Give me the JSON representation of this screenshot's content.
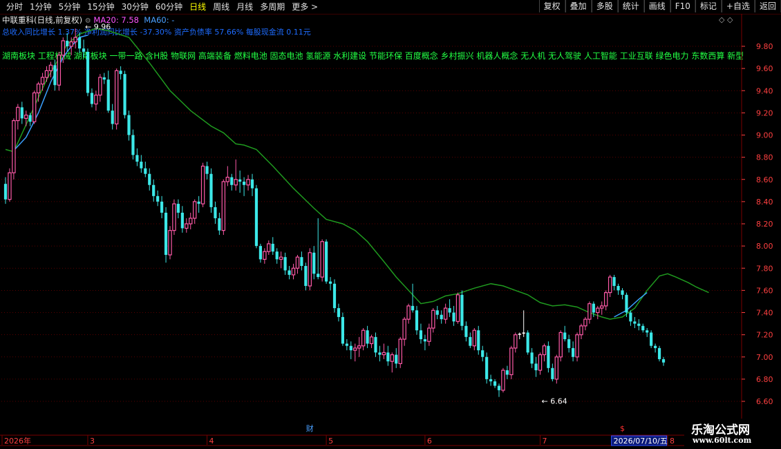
{
  "toolbar": {
    "left": [
      "分时",
      "1分钟",
      "5分钟",
      "15分钟",
      "30分钟",
      "60分钟",
      "日线",
      "周线",
      "月线",
      "多周期",
      "更多 >"
    ],
    "active_index": 6,
    "right": [
      "复权",
      "叠加",
      "多股",
      "统计",
      "画线",
      "F10",
      "标记",
      "+自选",
      "返回"
    ]
  },
  "info": {
    "name": "中联重科(日线,前复权)",
    "ma20": "MA20: 7.58",
    "ma60": "MA60: -",
    "diamonds": "◇ ◇"
  },
  "stats_text": "总收入同比增长 1.37%  净利润同比增长 -37.30%  资产负债率 57.66%  每股现金流 0.11元",
  "concepts_text": "湖南板块 工程机械 湖南板块 一带一路 含H股 物联网 高端装备 燃料电池 固态电池 氢能源 水利建设 节能环保 百度概念 乡村振兴 机器人概念 无人机 无人驾驶 人工智能 工业互联 绿色电力 东数西算 新型工业",
  "logo": {
    "line1": "乐淘公式网",
    "line2": "www.60lt.com"
  },
  "chart_data": {
    "type": "candlestick",
    "ylim": [
      6.5,
      10.0
    ],
    "y_ticks": [
      "6.60",
      "6.80",
      "7.00",
      "7.20",
      "7.40",
      "7.60",
      "7.80",
      "8.00",
      "8.20",
      "8.40",
      "8.60",
      "8.80",
      "9.00",
      "9.20",
      "9.40",
      "9.60",
      "9.80"
    ],
    "x_labels": [
      {
        "label": "2026年",
        "index": 0
      },
      {
        "label": "3",
        "index": 20
      },
      {
        "label": "4",
        "index": 49
      },
      {
        "label": "5",
        "index": 78
      },
      {
        "label": "6",
        "index": 102
      },
      {
        "label": "7",
        "index": 130
      },
      {
        "label": "8",
        "index": 161
      }
    ],
    "cursor_date": "2026/07/10/五",
    "cursor_index": 148,
    "markers": [
      {
        "label": "财",
        "index": 74
      },
      {
        "label": "$",
        "index": 150
      }
    ],
    "annotations": [
      {
        "text": "9.96",
        "index": 19
      },
      {
        "text": "6.64",
        "index": 130
      }
    ],
    "colors": {
      "up": "#ff5aa8",
      "down": "#3ce8e8",
      "ma20": "#1f9a1f",
      "ma_blue": "#3aa0ff",
      "tick": "#ff4040",
      "grid": "#7a0000"
    },
    "ohlc": [
      [
        8.56,
        8.62,
        8.38,
        8.42
      ],
      [
        8.42,
        8.7,
        8.4,
        8.66
      ],
      [
        8.66,
        9.15,
        8.6,
        9.13
      ],
      [
        9.13,
        9.28,
        9.05,
        9.25
      ],
      [
        9.25,
        9.3,
        9.1,
        9.15
      ],
      [
        9.15,
        9.22,
        9.08,
        9.18
      ],
      [
        9.18,
        9.2,
        9.08,
        9.12
      ],
      [
        9.12,
        9.4,
        9.1,
        9.38
      ],
      [
        9.38,
        9.48,
        9.3,
        9.46
      ],
      [
        9.46,
        9.56,
        9.4,
        9.52
      ],
      [
        9.52,
        9.62,
        9.48,
        9.58
      ],
      [
        9.58,
        9.66,
        9.52,
        9.63
      ],
      [
        9.63,
        9.68,
        9.4,
        9.45
      ],
      [
        9.45,
        9.75,
        9.4,
        9.72
      ],
      [
        9.72,
        9.88,
        9.65,
        9.85
      ],
      [
        9.85,
        9.92,
        9.75,
        9.8
      ],
      [
        9.8,
        9.88,
        9.72,
        9.84
      ],
      [
        9.84,
        9.96,
        9.78,
        9.88
      ],
      [
        9.88,
        9.92,
        9.74,
        9.78
      ],
      [
        9.78,
        9.86,
        9.7,
        9.75
      ],
      [
        9.75,
        9.78,
        9.35,
        9.38
      ],
      [
        9.38,
        9.42,
        9.25,
        9.28
      ],
      [
        9.28,
        9.4,
        9.22,
        9.36
      ],
      [
        9.36,
        9.55,
        9.3,
        9.52
      ],
      [
        9.52,
        9.56,
        9.46,
        9.5
      ],
      [
        9.5,
        9.58,
        9.2,
        9.22
      ],
      [
        9.22,
        9.28,
        9.05,
        9.1
      ],
      [
        9.1,
        9.6,
        9.05,
        9.58
      ],
      [
        9.58,
        9.62,
        9.5,
        9.55
      ],
      [
        9.55,
        9.58,
        9.15,
        9.18
      ],
      [
        9.18,
        9.22,
        8.95,
        9.0
      ],
      [
        9.0,
        9.05,
        8.78,
        8.82
      ],
      [
        8.82,
        8.88,
        8.72,
        8.76
      ],
      [
        8.76,
        8.82,
        8.66,
        8.7
      ],
      [
        8.7,
        8.76,
        8.62,
        8.65
      ],
      [
        8.65,
        8.7,
        8.5,
        8.55
      ],
      [
        8.55,
        8.6,
        8.4,
        8.45
      ],
      [
        8.45,
        8.5,
        8.36,
        8.4
      ],
      [
        8.4,
        8.45,
        8.25,
        8.3
      ],
      [
        8.3,
        8.35,
        7.85,
        7.92
      ],
      [
        7.92,
        8.18,
        7.88,
        8.14
      ],
      [
        8.14,
        8.42,
        8.1,
        8.38
      ],
      [
        8.38,
        8.42,
        8.25,
        8.3
      ],
      [
        8.3,
        8.36,
        8.12,
        8.16
      ],
      [
        8.16,
        8.25,
        8.12,
        8.2
      ],
      [
        8.2,
        8.3,
        8.15,
        8.25
      ],
      [
        8.25,
        8.42,
        8.2,
        8.4
      ],
      [
        8.4,
        8.45,
        8.3,
        8.38
      ],
      [
        8.38,
        8.75,
        8.35,
        8.72
      ],
      [
        8.72,
        8.76,
        8.6,
        8.65
      ],
      [
        8.65,
        8.7,
        8.3,
        8.35
      ],
      [
        8.35,
        8.4,
        8.2,
        8.25
      ],
      [
        8.25,
        8.3,
        8.1,
        8.14
      ],
      [
        8.14,
        8.6,
        8.1,
        8.58
      ],
      [
        8.58,
        8.72,
        8.54,
        8.62
      ],
      [
        8.62,
        8.65,
        8.5,
        8.55
      ],
      [
        8.55,
        8.78,
        8.5,
        8.6
      ],
      [
        8.6,
        8.68,
        8.48,
        8.58
      ],
      [
        8.58,
        8.62,
        8.45,
        8.55
      ],
      [
        8.55,
        8.64,
        8.5,
        8.6
      ],
      [
        8.6,
        8.65,
        8.45,
        8.52
      ],
      [
        8.52,
        8.55,
        7.98,
        8.0
      ],
      [
        8.0,
        8.02,
        7.85,
        7.88
      ],
      [
        7.88,
        7.98,
        7.84,
        7.95
      ],
      [
        7.95,
        8.05,
        7.92,
        8.02
      ],
      [
        8.02,
        8.08,
        7.92,
        7.95
      ],
      [
        7.95,
        7.98,
        7.84,
        7.88
      ],
      [
        7.88,
        7.95,
        7.8,
        7.9
      ],
      [
        7.9,
        7.94,
        7.74,
        7.78
      ],
      [
        7.78,
        7.82,
        7.7,
        7.74
      ],
      [
        7.74,
        7.84,
        7.7,
        7.8
      ],
      [
        7.8,
        7.92,
        7.75,
        7.9
      ],
      [
        7.9,
        7.95,
        7.78,
        7.82
      ],
      [
        7.82,
        7.85,
        7.6,
        7.64
      ],
      [
        7.64,
        7.98,
        7.6,
        7.94
      ],
      [
        7.94,
        8.0,
        7.7,
        7.75
      ],
      [
        7.75,
        8.25,
        7.7,
        7.72
      ],
      [
        7.72,
        8.06,
        7.68,
        8.04
      ],
      [
        8.04,
        8.06,
        7.66,
        7.68
      ],
      [
        7.68,
        7.72,
        7.6,
        7.66
      ],
      [
        7.66,
        7.7,
        7.4,
        7.44
      ],
      [
        7.44,
        7.48,
        7.32,
        7.36
      ],
      [
        7.36,
        7.4,
        7.1,
        7.12
      ],
      [
        7.12,
        7.16,
        7.06,
        7.1
      ],
      [
        7.1,
        7.14,
        6.98,
        7.06
      ],
      [
        7.06,
        7.12,
        6.96,
        7.08
      ],
      [
        7.08,
        7.18,
        7.0,
        7.1
      ],
      [
        7.1,
        7.26,
        7.06,
        7.24
      ],
      [
        7.24,
        7.28,
        7.08,
        7.12
      ],
      [
        7.12,
        7.2,
        7.08,
        7.18
      ],
      [
        7.18,
        7.22,
        7.0,
        7.04
      ],
      [
        7.04,
        7.1,
        6.96,
        7.02
      ],
      [
        7.02,
        7.12,
        6.98,
        7.04
      ],
      [
        7.04,
        7.1,
        6.92,
        6.96
      ],
      [
        6.96,
        7.04,
        6.86,
        7.02
      ],
      [
        7.02,
        7.08,
        6.9,
        6.94
      ],
      [
        6.94,
        7.18,
        6.9,
        7.16
      ],
      [
        7.16,
        7.36,
        7.1,
        7.34
      ],
      [
        7.34,
        7.48,
        7.3,
        7.46
      ],
      [
        7.46,
        7.66,
        7.4,
        7.42
      ],
      [
        7.42,
        7.46,
        7.2,
        7.24
      ],
      [
        7.24,
        7.3,
        7.12,
        7.16
      ],
      [
        7.16,
        7.2,
        7.06,
        7.14
      ],
      [
        7.14,
        7.3,
        7.1,
        7.26
      ],
      [
        7.26,
        7.44,
        7.22,
        7.42
      ],
      [
        7.42,
        7.46,
        7.34,
        7.38
      ],
      [
        7.38,
        7.42,
        7.3,
        7.34
      ],
      [
        7.34,
        7.48,
        7.3,
        7.44
      ],
      [
        7.44,
        7.52,
        7.36,
        7.4
      ],
      [
        7.4,
        7.46,
        7.28,
        7.32
      ],
      [
        7.32,
        7.58,
        7.3,
        7.56
      ],
      [
        7.56,
        7.6,
        7.24,
        7.28
      ],
      [
        7.28,
        7.32,
        7.14,
        7.18
      ],
      [
        7.18,
        7.22,
        7.08,
        7.1
      ],
      [
        7.1,
        7.26,
        7.06,
        7.24
      ],
      [
        7.24,
        7.28,
        7.02,
        7.06
      ],
      [
        7.06,
        7.1,
        6.96,
        7.0
      ],
      [
        7.0,
        7.04,
        6.76,
        6.8
      ],
      [
        6.8,
        6.84,
        6.74,
        6.78
      ],
      [
        6.78,
        6.8,
        6.72,
        6.74
      ],
      [
        6.74,
        6.76,
        6.64,
        6.7
      ],
      [
        6.7,
        6.9,
        6.68,
        6.88
      ],
      [
        6.88,
        6.92,
        6.8,
        6.84
      ],
      [
        6.84,
        7.1,
        6.8,
        7.08
      ],
      [
        7.08,
        7.22,
        7.04,
        7.2
      ],
      [
        7.2,
        7.22,
        7.16,
        7.21
      ],
      [
        7.21,
        7.42,
        7.18,
        7.22
      ],
      [
        7.22,
        7.24,
        7.02,
        7.04
      ],
      [
        7.04,
        7.08,
        6.9,
        6.94
      ],
      [
        6.94,
        7.0,
        6.82,
        6.88
      ],
      [
        6.88,
        7.04,
        6.84,
        7.02
      ],
      [
        7.02,
        7.12,
        6.96,
        7.1
      ],
      [
        7.1,
        7.14,
        6.86,
        6.9
      ],
      [
        6.9,
        6.94,
        6.78,
        6.8
      ],
      [
        6.8,
        7.02,
        6.76,
        7.0
      ],
      [
        7.0,
        7.24,
        6.96,
        7.22
      ],
      [
        7.22,
        7.28,
        7.14,
        7.16
      ],
      [
        7.16,
        7.2,
        7.04,
        7.08
      ],
      [
        7.08,
        7.14,
        6.96,
        7.0
      ],
      [
        7.0,
        7.22,
        6.96,
        7.2
      ],
      [
        7.2,
        7.3,
        7.16,
        7.28
      ],
      [
        7.28,
        7.36,
        7.24,
        7.34
      ],
      [
        7.34,
        7.5,
        7.3,
        7.48
      ],
      [
        7.48,
        7.5,
        7.36,
        7.4
      ],
      [
        7.4,
        7.46,
        7.34,
        7.44
      ],
      [
        7.44,
        7.5,
        7.38,
        7.46
      ],
      [
        7.46,
        7.6,
        7.42,
        7.58
      ],
      [
        7.58,
        7.74,
        7.54,
        7.72
      ],
      [
        7.72,
        7.74,
        7.6,
        7.64
      ],
      [
        7.64,
        7.66,
        7.56,
        7.6
      ],
      [
        7.6,
        7.62,
        7.52,
        7.56
      ],
      [
        7.56,
        7.58,
        7.36,
        7.4
      ],
      [
        7.4,
        7.42,
        7.28,
        7.32
      ],
      [
        7.32,
        7.36,
        7.26,
        7.3
      ],
      [
        7.3,
        7.34,
        7.24,
        7.28
      ],
      [
        7.28,
        7.3,
        7.22,
        7.24
      ],
      [
        7.24,
        7.26,
        7.18,
        7.22
      ],
      [
        7.22,
        7.24,
        7.08,
        7.1
      ],
      [
        7.1,
        7.12,
        7.04,
        7.08
      ],
      [
        7.08,
        7.1,
        6.96,
        6.98
      ],
      [
        6.98,
        7.0,
        6.92,
        6.95
      ]
    ],
    "ma20": [
      [
        0,
        8.87
      ],
      [
        1,
        8.86
      ],
      [
        2,
        8.85
      ],
      [
        10,
        9.5
      ],
      [
        15,
        9.82
      ],
      [
        18,
        9.91
      ],
      [
        22,
        9.96
      ],
      [
        25,
        9.94
      ],
      [
        30,
        9.88
      ],
      [
        35,
        9.65
      ],
      [
        40,
        9.4
      ],
      [
        45,
        9.22
      ],
      [
        50,
        9.08
      ],
      [
        53,
        9.02
      ],
      [
        56,
        8.92
      ],
      [
        58,
        8.91
      ],
      [
        61,
        8.87
      ],
      [
        65,
        8.72
      ],
      [
        70,
        8.52
      ],
      [
        75,
        8.34
      ],
      [
        78,
        8.24
      ],
      [
        82,
        8.2
      ],
      [
        85,
        8.14
      ],
      [
        88,
        8.04
      ],
      [
        92,
        7.86
      ],
      [
        95,
        7.72
      ],
      [
        99,
        7.56
      ],
      [
        101,
        7.48
      ],
      [
        104,
        7.5
      ],
      [
        107,
        7.55
      ],
      [
        110,
        7.57
      ],
      [
        114,
        7.62
      ],
      [
        118,
        7.66
      ],
      [
        121,
        7.64
      ],
      [
        124,
        7.6
      ],
      [
        127,
        7.56
      ],
      [
        130,
        7.49
      ],
      [
        133,
        7.46
      ],
      [
        136,
        7.47
      ],
      [
        139,
        7.45
      ],
      [
        142,
        7.4
      ],
      [
        145,
        7.36
      ],
      [
        147,
        7.34
      ],
      [
        150,
        7.36
      ],
      [
        153,
        7.44
      ],
      [
        156,
        7.6
      ],
      [
        159,
        7.73
      ],
      [
        161,
        7.75
      ],
      [
        163,
        7.72
      ],
      [
        166,
        7.67
      ],
      [
        168,
        7.63
      ],
      [
        171,
        7.58
      ]
    ],
    "ma_blue_a": [
      [
        2,
        8.86
      ],
      [
        5,
        8.98
      ],
      [
        8,
        9.2
      ],
      [
        11,
        9.48
      ],
      [
        14,
        9.7
      ],
      [
        16,
        9.8
      ],
      [
        18,
        9.88
      ],
      [
        20,
        9.9
      ]
    ],
    "ma_blue_b": [
      [
        148,
        7.36
      ],
      [
        151,
        7.42
      ],
      [
        154,
        7.52
      ],
      [
        156,
        7.58
      ]
    ]
  }
}
